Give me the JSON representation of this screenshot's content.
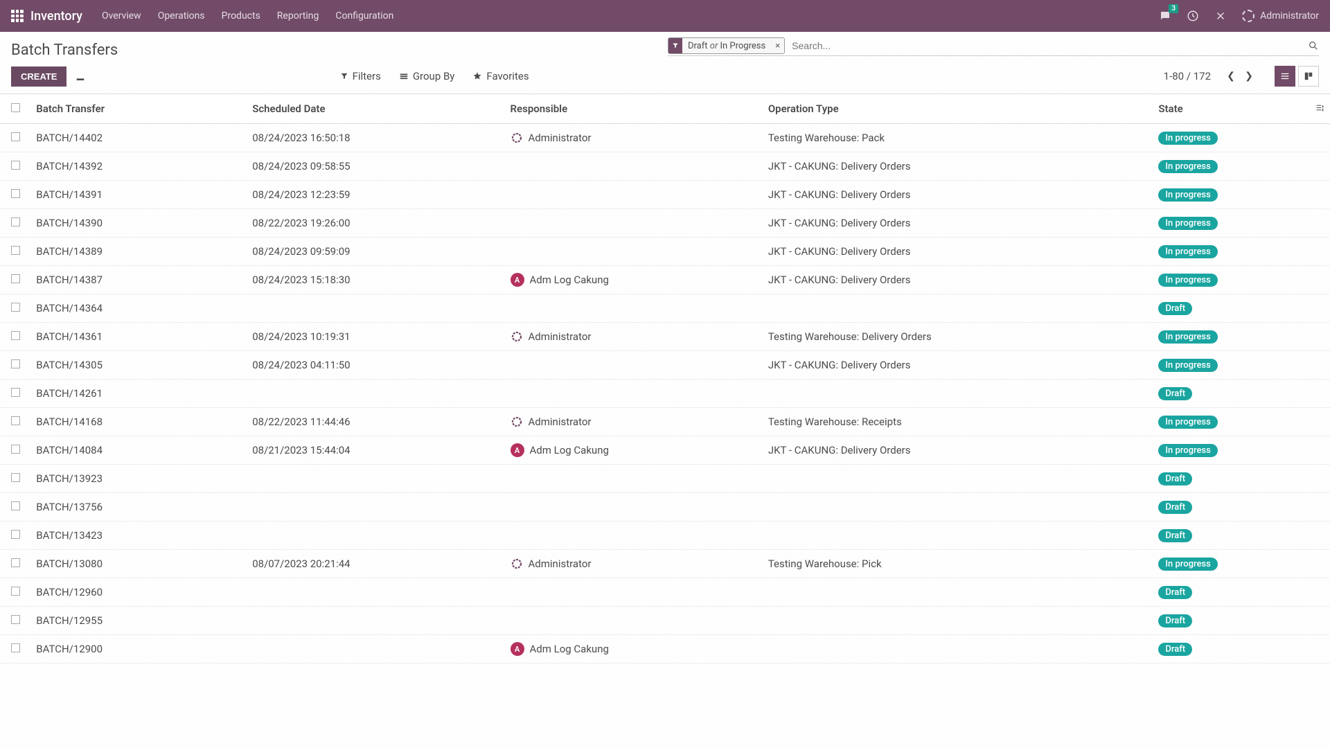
{
  "nav": {
    "brand": "Inventory",
    "items": [
      "Overview",
      "Operations",
      "Products",
      "Reporting",
      "Configuration"
    ],
    "chat_count": "3",
    "user": "Administrator"
  },
  "header": {
    "title": "Batch Transfers",
    "create": "CREATE",
    "filter_chip_a": "Draft ",
    "filter_chip_op": "or",
    "filter_chip_b": " In Progress",
    "search_placeholder": "Search...",
    "filters": "Filters",
    "groupby": "Group By",
    "favorites": "Favorites",
    "pager": "1-80 / 172"
  },
  "table": {
    "cols": {
      "name": "Batch Transfer",
      "date": "Scheduled Date",
      "resp": "Responsible",
      "op": "Operation Type",
      "state": "State"
    },
    "states": {
      "progress": "In progress",
      "draft": "Draft"
    },
    "resp_admin": "Administrator",
    "resp_adm": "Adm Log Cakung",
    "rows": [
      {
        "n": "BATCH/14402",
        "d": "08/24/2023 16:50:18",
        "r": "admin",
        "o": "Testing Warehouse: Pack",
        "s": "progress"
      },
      {
        "n": "BATCH/14392",
        "d": "08/24/2023 09:58:55",
        "r": "",
        "o": "JKT - CAKUNG: Delivery Orders",
        "s": "progress"
      },
      {
        "n": "BATCH/14391",
        "d": "08/24/2023 12:23:59",
        "r": "",
        "o": "JKT - CAKUNG: Delivery Orders",
        "s": "progress"
      },
      {
        "n": "BATCH/14390",
        "d": "08/22/2023 19:26:00",
        "r": "",
        "o": "JKT - CAKUNG: Delivery Orders",
        "s": "progress"
      },
      {
        "n": "BATCH/14389",
        "d": "08/24/2023 09:59:09",
        "r": "",
        "o": "JKT - CAKUNG: Delivery Orders",
        "s": "progress"
      },
      {
        "n": "BATCH/14387",
        "d": "08/24/2023 15:18:30",
        "r": "adm",
        "o": "JKT - CAKUNG: Delivery Orders",
        "s": "progress"
      },
      {
        "n": "BATCH/14364",
        "d": "",
        "r": "",
        "o": "",
        "s": "draft"
      },
      {
        "n": "BATCH/14361",
        "d": "08/24/2023 10:19:31",
        "r": "admin",
        "o": "Testing Warehouse: Delivery Orders",
        "s": "progress"
      },
      {
        "n": "BATCH/14305",
        "d": "08/24/2023 04:11:50",
        "r": "",
        "o": "JKT - CAKUNG: Delivery Orders",
        "s": "progress"
      },
      {
        "n": "BATCH/14261",
        "d": "",
        "r": "",
        "o": "",
        "s": "draft"
      },
      {
        "n": "BATCH/14168",
        "d": "08/22/2023 11:44:46",
        "r": "admin",
        "o": "Testing Warehouse: Receipts",
        "s": "progress"
      },
      {
        "n": "BATCH/14084",
        "d": "08/21/2023 15:44:04",
        "r": "adm",
        "o": "JKT - CAKUNG: Delivery Orders",
        "s": "progress"
      },
      {
        "n": "BATCH/13923",
        "d": "",
        "r": "",
        "o": "",
        "s": "draft"
      },
      {
        "n": "BATCH/13756",
        "d": "",
        "r": "",
        "o": "",
        "s": "draft"
      },
      {
        "n": "BATCH/13423",
        "d": "",
        "r": "",
        "o": "",
        "s": "draft"
      },
      {
        "n": "BATCH/13080",
        "d": "08/07/2023 20:21:44",
        "r": "admin",
        "o": "Testing Warehouse: Pick",
        "s": "progress"
      },
      {
        "n": "BATCH/12960",
        "d": "",
        "r": "",
        "o": "",
        "s": "draft"
      },
      {
        "n": "BATCH/12955",
        "d": "",
        "r": "",
        "o": "",
        "s": "draft"
      },
      {
        "n": "BATCH/12900",
        "d": "",
        "r": "adm",
        "o": "",
        "s": "draft"
      }
    ]
  }
}
